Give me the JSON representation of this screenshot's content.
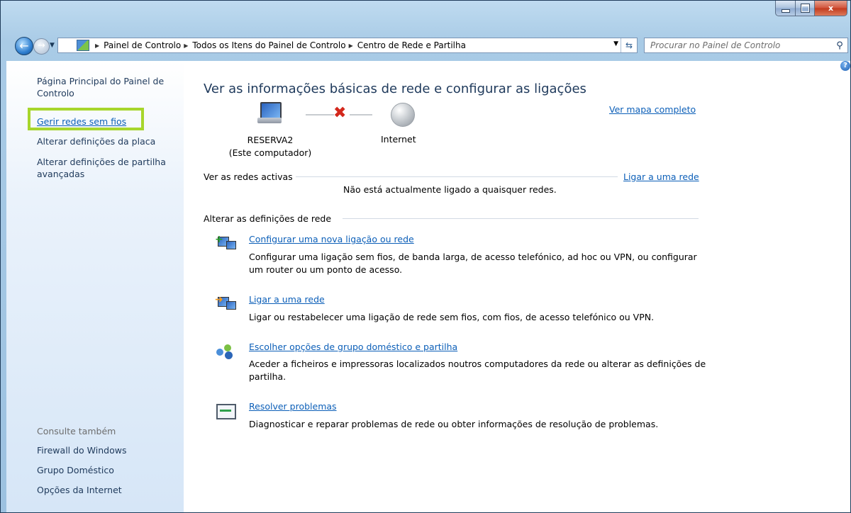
{
  "window": {
    "minimize_label": "–",
    "maximize_label": "□",
    "close_label": "x"
  },
  "nav": {
    "back_label": "←",
    "forward_label": "→",
    "breadcrumbs": [
      "Painel de Controlo",
      "Todos os Itens do Painel de Controlo",
      "Centro de Rede e Partilha"
    ],
    "search_placeholder": "Procurar no Painel de Controlo"
  },
  "sidebar": {
    "home": "Página Principal do Painel de Controlo",
    "wireless": "Gerir redes sem fios",
    "adapter": "Alterar definições da placa",
    "advanced_sharing": "Alterar definições de partilha avançadas",
    "see_also": "Consulte também",
    "firewall": "Firewall do Windows",
    "homegroup": "Grupo Doméstico",
    "internet_options": "Opções da Internet"
  },
  "main": {
    "title": "Ver as informações básicas de rede e configurar as ligações",
    "full_map_link": "Ver mapa completo",
    "computer_name": "RESERVA2",
    "computer_sub": "(Este computador)",
    "internet_label": "Internet",
    "active_networks_heading": "Ver as redes activas",
    "connect_link": "Ligar a uma rede",
    "no_networks": "Não está actualmente ligado a quaisquer redes.",
    "change_settings_heading": "Alterar as definições de rede",
    "tasks": [
      {
        "title": "Configurar uma nova ligação ou rede",
        "desc": "Configurar uma ligação sem fios, de banda larga, de acesso telefónico, ad hoc ou VPN, ou configurar um router ou um ponto de acesso."
      },
      {
        "title": "Ligar a uma rede",
        "desc": "Ligar ou restabelecer uma ligação de rede sem fios, com fios, de acesso telefónico ou VPN."
      },
      {
        "title": "Escolher opções de grupo doméstico e partilha",
        "desc": "Aceder a ficheiros e impressoras localizados noutros computadores da rede ou alterar as definições de partilha."
      },
      {
        "title": "Resolver problemas",
        "desc": "Diagnosticar e reparar problemas de rede ou obter informações de resolução de problemas."
      }
    ]
  },
  "colors": {
    "link": "#0c5fb8",
    "highlight": "#a7d62c",
    "error_cross": "#d3281c"
  }
}
